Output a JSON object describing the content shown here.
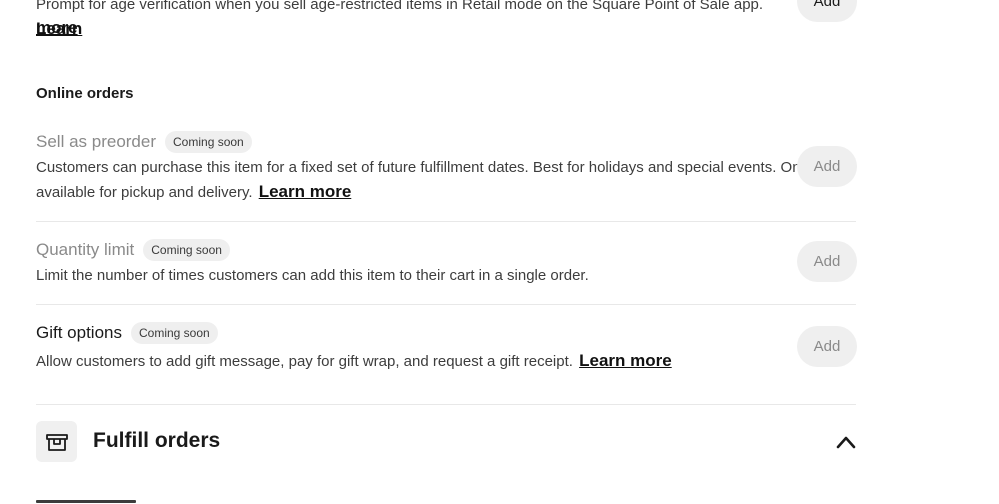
{
  "age_verification": {
    "description": "Prompt for age verification when you sell age-restricted items in Retail mode on the Square Point of Sale app.",
    "learn_more": "Learn",
    "learn_more_cont": "more",
    "add_label": "Add"
  },
  "online_orders": {
    "header": "Online orders",
    "items": [
      {
        "title": "Sell as preorder",
        "badge": "Coming soon",
        "description_line1": "Customers can purchase this item for a fixed set of future fulfillment dates. Best for holidays and special events. Only",
        "description_line2": "available for pickup and delivery.",
        "learn_more": "Learn more",
        "add_label": "Add"
      },
      {
        "title": "Quantity limit",
        "badge": "Coming soon",
        "description": "Limit the number of times customers can add this item to their cart in a single order.",
        "add_label": "Add"
      },
      {
        "title": "Gift options",
        "badge": "Coming soon",
        "description": "Allow customers to add gift message, pay for gift wrap, and request a gift receipt.",
        "learn_more": "Learn more",
        "add_label": "Add"
      }
    ]
  },
  "fulfill_orders": {
    "title": "Fulfill orders",
    "icon": "box-icon",
    "toggle_icon": "chevron-up-icon"
  }
}
